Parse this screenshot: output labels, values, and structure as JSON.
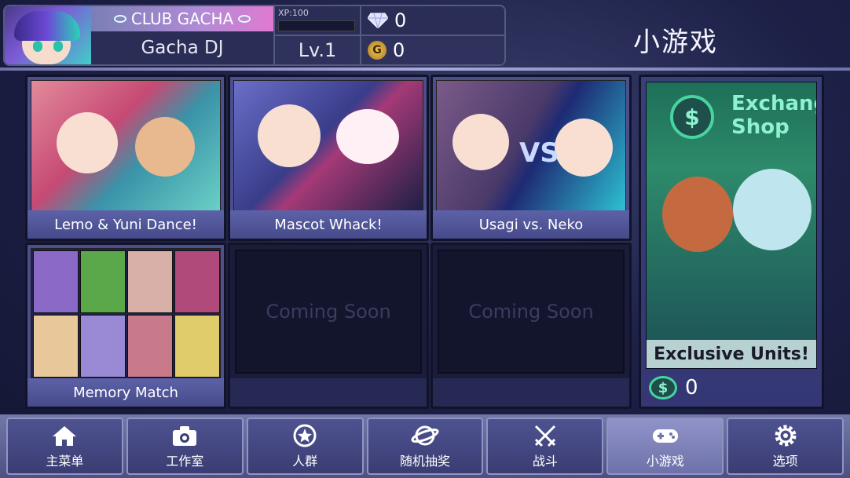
{
  "header": {
    "club": "CLUB GACHA",
    "player_name": "Gacha DJ",
    "xp_label": "XP:100",
    "level": "Lv.1",
    "diamonds": "0",
    "gold_icon": "G",
    "gold": "0"
  },
  "page_title": "小游戏",
  "games": [
    {
      "label": "Lemo & Yuni Dance!"
    },
    {
      "label": "Mascot Whack!"
    },
    {
      "label": "Usagi vs. Neko",
      "art_text": "VS"
    },
    {
      "label": "Memory Match"
    },
    {
      "label": "",
      "coming_soon": "Coming Soon"
    },
    {
      "label": "",
      "coming_soon": "Coming Soon"
    }
  ],
  "shop": {
    "title_line1": "Exchange",
    "title_line2": "Shop",
    "icon_symbol": "$",
    "banner": "Exclusive Units!",
    "tokens": "0"
  },
  "nav": [
    {
      "label": "主菜单",
      "icon": "home-icon"
    },
    {
      "label": "工作室",
      "icon": "camera-icon"
    },
    {
      "label": "人群",
      "icon": "star-icon"
    },
    {
      "label": "随机抽奖",
      "icon": "planet-icon"
    },
    {
      "label": "战斗",
      "icon": "swords-icon"
    },
    {
      "label": "小游戏",
      "icon": "gamepad-icon",
      "active": true
    },
    {
      "label": "选项",
      "icon": "gear-icon"
    }
  ],
  "colors": {
    "accent": "#48d4a0",
    "card": "#4c4f8a",
    "background": "#1d2147"
  }
}
